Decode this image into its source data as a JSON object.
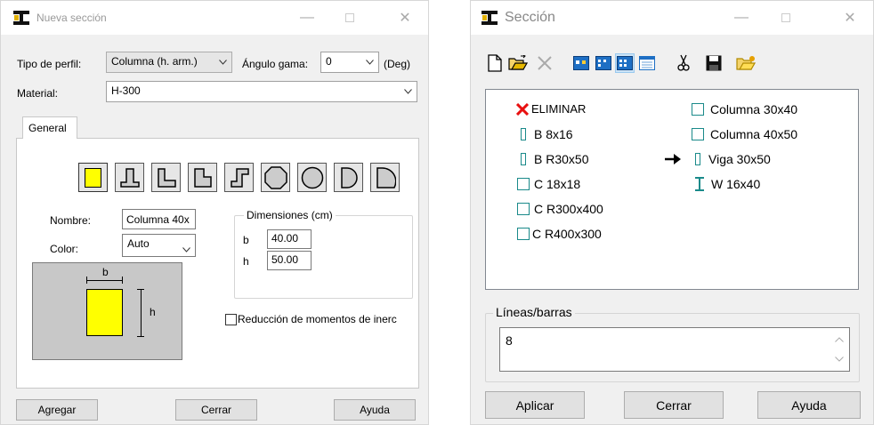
{
  "left_window": {
    "title": "Nueva sección",
    "tipo_perfil": {
      "label": "Tipo de perfil:",
      "value": "Columna (h. arm.)"
    },
    "angulo_gama": {
      "label": "Ángulo gama:",
      "value": "0",
      "unit": "(Deg)"
    },
    "material": {
      "label": "Material:",
      "value": "H-300"
    },
    "tab_general": "General",
    "nombre": {
      "label": "Nombre:",
      "value": "Columna 40x"
    },
    "color": {
      "label": "Color:",
      "value": "Auto"
    },
    "dimensiones": {
      "title": "Dimensiones (cm)",
      "b_label": "b",
      "b_value": "40.00",
      "h_label": "h",
      "h_value": "50.00"
    },
    "preview": {
      "b_label": "b",
      "h_label": "h"
    },
    "reduccion": "Reducción de momentos de inerc",
    "buttons": {
      "agregar": "Agregar",
      "cerrar": "Cerrar",
      "ayuda": "Ayuda"
    }
  },
  "right_window": {
    "title": "Sección",
    "list_left": [
      {
        "text": "ELIMINAR",
        "icon": "delete-x-icon"
      },
      {
        "text": "B 8x16",
        "icon": "tall-rect-icon"
      },
      {
        "text": "B R30x50",
        "icon": "tall-rect-icon"
      },
      {
        "text": "C 18x18",
        "icon": "square-icon"
      },
      {
        "text": "C R300x400",
        "icon": "square-icon"
      },
      {
        "text": "C R400x300",
        "icon": "square-icon"
      }
    ],
    "list_right": [
      {
        "text": "Columna 30x40",
        "icon": "square-icon"
      },
      {
        "text": "Columna 40x50",
        "icon": "square-icon"
      },
      {
        "text": "Viga 30x50",
        "icon": "tall-rect-icon",
        "marker": "arrow-right-icon"
      },
      {
        "text": "W 16x40",
        "icon": "i-beam-icon"
      }
    ],
    "lineas": {
      "title": "Líneas/barras",
      "value": "8"
    },
    "buttons": {
      "aplicar": "Aplicar",
      "cerrar": "Cerrar",
      "ayuda": "Ayuda"
    }
  },
  "colors": {
    "preview_fill": "#ffff00",
    "selected_blue": "#cce4f7",
    "teal": "#1a8a8a",
    "delete_red": "#e81010"
  }
}
